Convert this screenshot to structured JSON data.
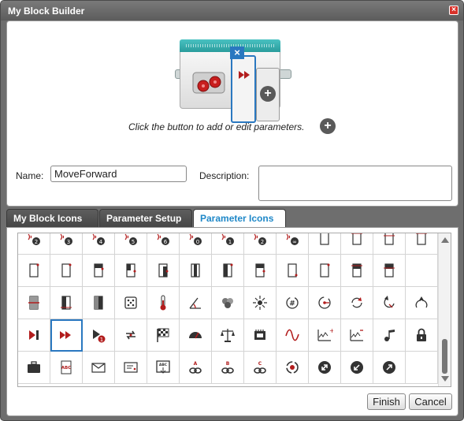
{
  "window": {
    "title": "My Block Builder",
    "close_label": "×"
  },
  "builder": {
    "hint_text": "Click the button to add or edit parameters.",
    "slot_close_label": "×",
    "plus_label": "+"
  },
  "form": {
    "name_label": "Name:",
    "name_value": "MoveForward",
    "description_label": "Description:",
    "description_value": ""
  },
  "tabs": [
    {
      "label": "My Block Icons",
      "active": false
    },
    {
      "label": "Parameter Setup",
      "active": false
    },
    {
      "label": "Parameter Icons",
      "active": true
    }
  ],
  "icons": [
    "sensor-port-2-icon",
    "sensor-port-3-icon",
    "sensor-port-4-icon",
    "sensor-port-5-icon",
    "sensor-port-6-icon",
    "sensor-port-0-icon",
    "sensor-port-1-icon",
    "sensor-port-2-alt-icon",
    "sensor-port-infinity-icon",
    "frame-top-icon",
    "frame-top-line-icon",
    "frame-top-line-2-icon",
    "frame-top-line-3-icon",
    "frame-dot-tr-icon",
    "frame-dot-tr-2-icon",
    "frame-half-dark-icon",
    "frame-dark-right-icon",
    "frame-dark-right-2-icon",
    "frame-dark-center-icon",
    "frame-dark-left-icon",
    "frame-half-icon",
    "frame-dot-br-icon",
    "frame-dot-tr-3-icon",
    "frame-dark-top-icon",
    "frame-dark-line-icon",
    "",
    "frame-midline-icon",
    "frame-dark-line-2-icon",
    "frame-dark-gray-icon",
    "dice-icon",
    "thermometer-icon",
    "angle-icon",
    "color-dots-icon",
    "light-icon",
    "rotate-number-icon",
    "rotate-right-icon",
    "rotate-arrows-icon",
    "rotate-back-icon",
    "rotate-up-icon",
    "play-stop-icon",
    "fast-forward-icon",
    "play-count-icon",
    "loop-icon",
    "checkered-flag-icon",
    "gauge-icon",
    "scale-icon",
    "memory-chip-icon",
    "wave-icon",
    "graph-plus-icon",
    "graph-minus-icon",
    "music-note-icon",
    "lock-icon",
    "briefcase-icon",
    "text-file-icon",
    "envelope-icon",
    "message-icon",
    "display-icon",
    "link-a-icon",
    "link-b-icon",
    "link-c-icon",
    "target-icon",
    "arrow-ne-icon",
    "arrow-sw-icon",
    "arrow-ne-2-icon",
    ""
  ],
  "selected_icon_index": 40,
  "buttons": {
    "finish_label": "Finish",
    "cancel_label": "Cancel"
  },
  "colors": {
    "accent": "#2a78c0",
    "teal": "#2a9c9c",
    "icon_red": "#b21d1d",
    "icon_dark": "#333333"
  }
}
